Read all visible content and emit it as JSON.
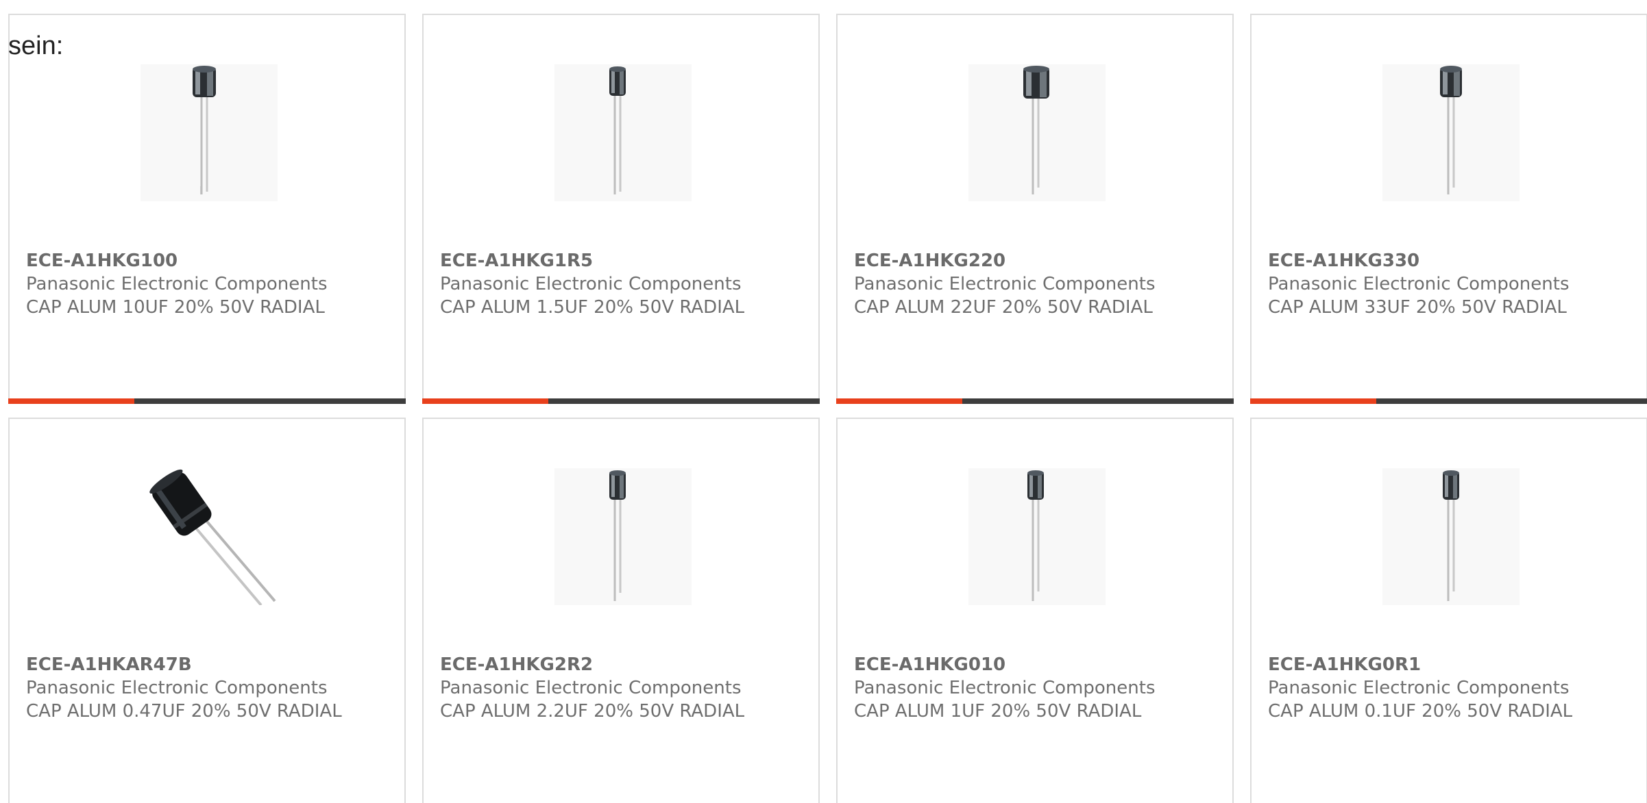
{
  "intro": {
    "text": "sein:"
  },
  "colors": {
    "accent": "#e8401c",
    "bar": "#3d3d3d",
    "border": "#dcdcdc",
    "text": "#6e6e6e"
  },
  "products": [
    {
      "part_number": "ECE-A1HKG100",
      "manufacturer": "Panasonic Electronic Components",
      "description": "CAP ALUM 10UF 20% 50V RADIAL",
      "image": "radial-capacitor-image"
    },
    {
      "part_number": "ECE-A1HKG1R5",
      "manufacturer": "Panasonic Electronic Components",
      "description": "CAP ALUM 1.5UF 20% 50V RADIAL",
      "image": "radial-capacitor-image"
    },
    {
      "part_number": "ECE-A1HKG220",
      "manufacturer": "Panasonic Electronic Components",
      "description": "CAP ALUM 22UF 20% 50V RADIAL",
      "image": "radial-capacitor-image"
    },
    {
      "part_number": "ECE-A1HKG330",
      "manufacturer": "Panasonic Electronic Components",
      "description": "CAP ALUM 33UF 20% 50V RADIAL",
      "image": "radial-capacitor-image"
    },
    {
      "part_number": "ECE-A1HKAR47B",
      "manufacturer": "Panasonic Electronic Components",
      "description": "CAP ALUM 0.47UF 20% 50V RADIAL",
      "image": "radial-capacitor-angled-image"
    },
    {
      "part_number": "ECE-A1HKG2R2",
      "manufacturer": "Panasonic Electronic Components",
      "description": "CAP ALUM 2.2UF 20% 50V RADIAL",
      "image": "radial-capacitor-image"
    },
    {
      "part_number": "ECE-A1HKG010",
      "manufacturer": "Panasonic Electronic Components",
      "description": "CAP ALUM 1UF 20% 50V RADIAL",
      "image": "radial-capacitor-image"
    },
    {
      "part_number": "ECE-A1HKG0R1",
      "manufacturer": "Panasonic Electronic Components",
      "description": "CAP ALUM 0.1UF 20% 50V RADIAL",
      "image": "radial-capacitor-image"
    }
  ]
}
